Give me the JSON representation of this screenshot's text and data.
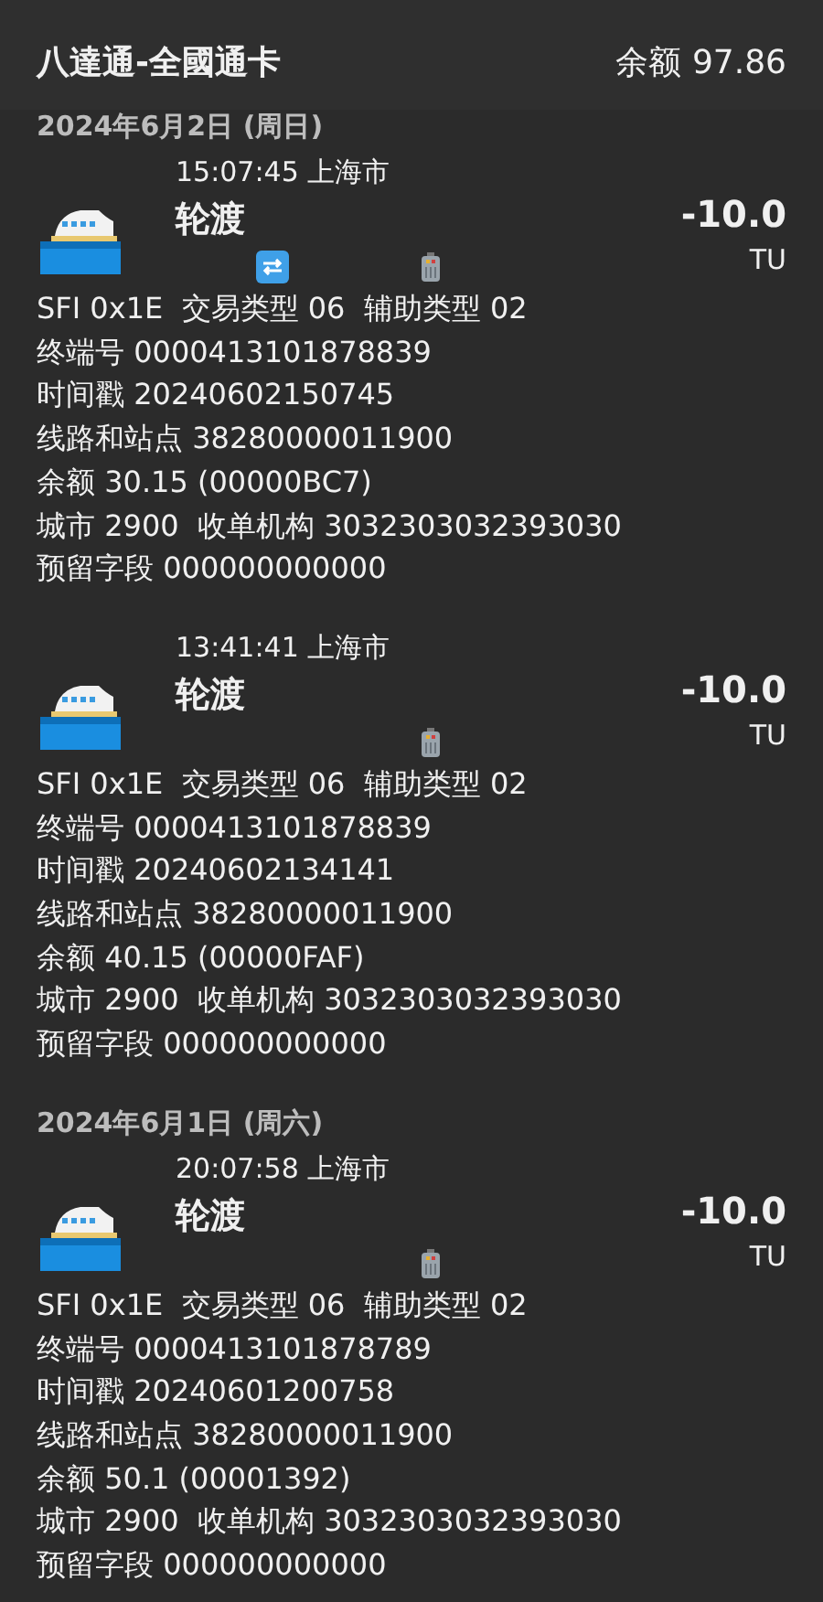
{
  "header": {
    "title": "八達通-全國通卡",
    "balance": "余额 97.86"
  },
  "groups": [
    {
      "date": "2024年6月2日 (周日)",
      "transactions": [
        {
          "time": "15:07:45",
          "city": "上海市",
          "title": "轮渡",
          "amount": "-10.0",
          "unit": "TU",
          "transfer": true,
          "details": [
            "SFI 0x1E  交易类型 06  辅助类型 02",
            "终端号 0000413101878839",
            "时间戳 20240602150745",
            "线路和站点 38280000011900",
            "余额 30.15 (00000BC7)",
            "城市 2900  收单机构 3032303032393030",
            "预留字段 000000000000"
          ]
        },
        {
          "time": "13:41:41",
          "city": "上海市",
          "title": "轮渡",
          "amount": "-10.0",
          "unit": "TU",
          "transfer": false,
          "details": [
            "SFI 0x1E  交易类型 06  辅助类型 02",
            "终端号 0000413101878839",
            "时间戳 20240602134141",
            "线路和站点 38280000011900",
            "余额 40.15 (00000FAF)",
            "城市 2900  收单机构 3032303032393030",
            "预留字段 000000000000"
          ]
        }
      ]
    },
    {
      "date": "2024年6月1日 (周六)",
      "transactions": [
        {
          "time": "20:07:58",
          "city": "上海市",
          "title": "轮渡",
          "amount": "-10.0",
          "unit": "TU",
          "transfer": false,
          "details": [
            "SFI 0x1E  交易类型 06  辅助类型 02",
            "终端号 0000413101878789",
            "时间戳 20240601200758",
            "线路和站点 38280000011900",
            "余额 50.1 (00001392)",
            "城市 2900  收单机构 3032303032393030",
            "预留字段 000000000000"
          ]
        }
      ]
    }
  ]
}
